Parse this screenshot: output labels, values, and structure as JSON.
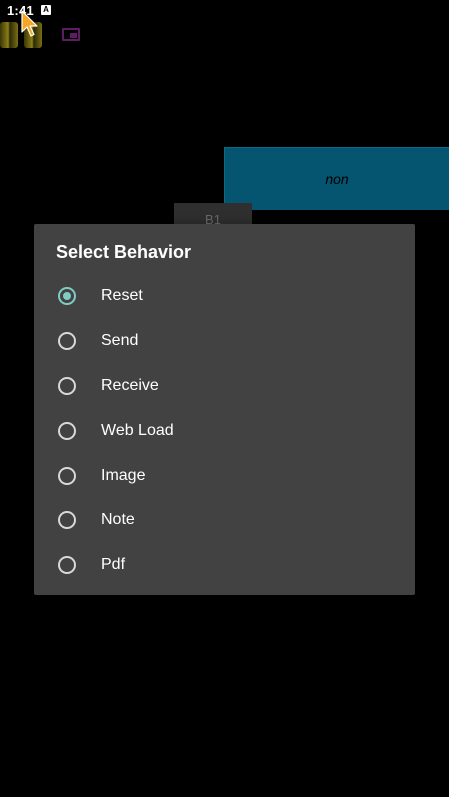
{
  "status_bar": {
    "time": "1:41",
    "notification_icon": "accessibility-a-icon",
    "notification_glyph": "A"
  },
  "background_panel": {
    "label": "non",
    "color": "#055470"
  },
  "background_button": {
    "label": "B1"
  },
  "dialog": {
    "title": "Select Behavior",
    "accent_color": "#80cbc4",
    "options": [
      {
        "label": "Reset",
        "selected": true
      },
      {
        "label": "Send",
        "selected": false
      },
      {
        "label": "Receive",
        "selected": false
      },
      {
        "label": "Web Load",
        "selected": false
      },
      {
        "label": "Image",
        "selected": false
      },
      {
        "label": "Note",
        "selected": false
      },
      {
        "label": "Pdf",
        "selected": false
      }
    ]
  }
}
